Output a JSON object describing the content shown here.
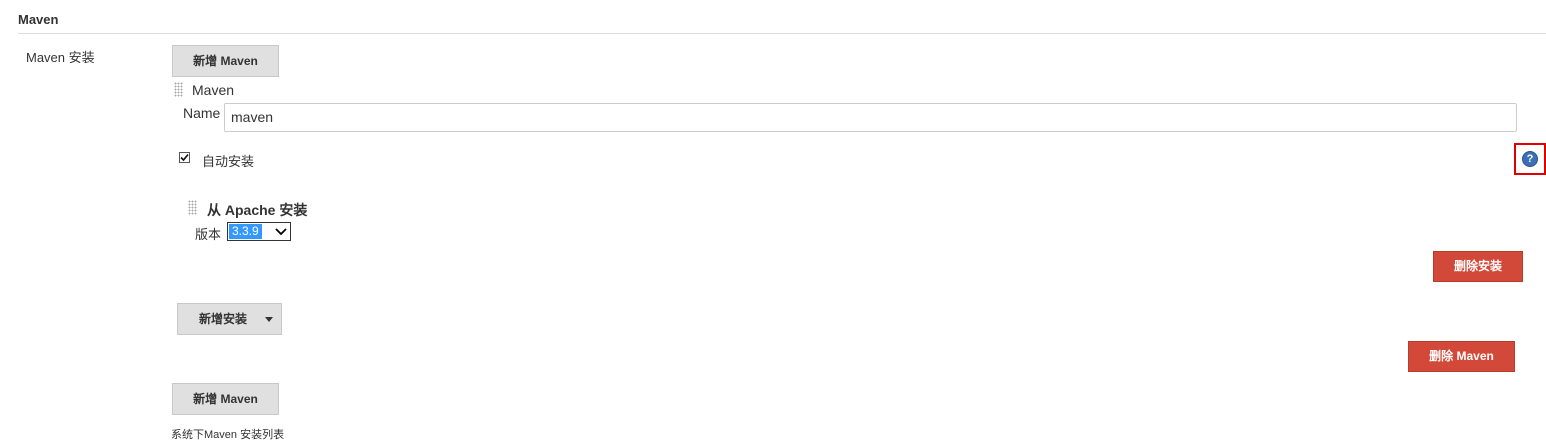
{
  "section": {
    "title": "Maven"
  },
  "maven_install": {
    "label": "Maven 安装",
    "add_button_top": "新增 Maven",
    "entry": {
      "header": "Maven",
      "name_label": "Name",
      "name_value": "maven",
      "auto_install": {
        "label": "自动安装",
        "checked": true
      },
      "help_icon": "help-icon",
      "installer": {
        "title": "从 Apache 安装",
        "version_label": "版本",
        "version_value": "3.3.9"
      },
      "delete_installer_button": "删除安装",
      "add_installer_button": "新增安装",
      "delete_maven_button": "删除 Maven"
    },
    "add_button_bottom": "新增 Maven",
    "description": "系统下Maven 安装列表"
  },
  "colors": {
    "danger": "#d24939",
    "help_highlight": "#e00000",
    "selection": "#3399ff"
  }
}
